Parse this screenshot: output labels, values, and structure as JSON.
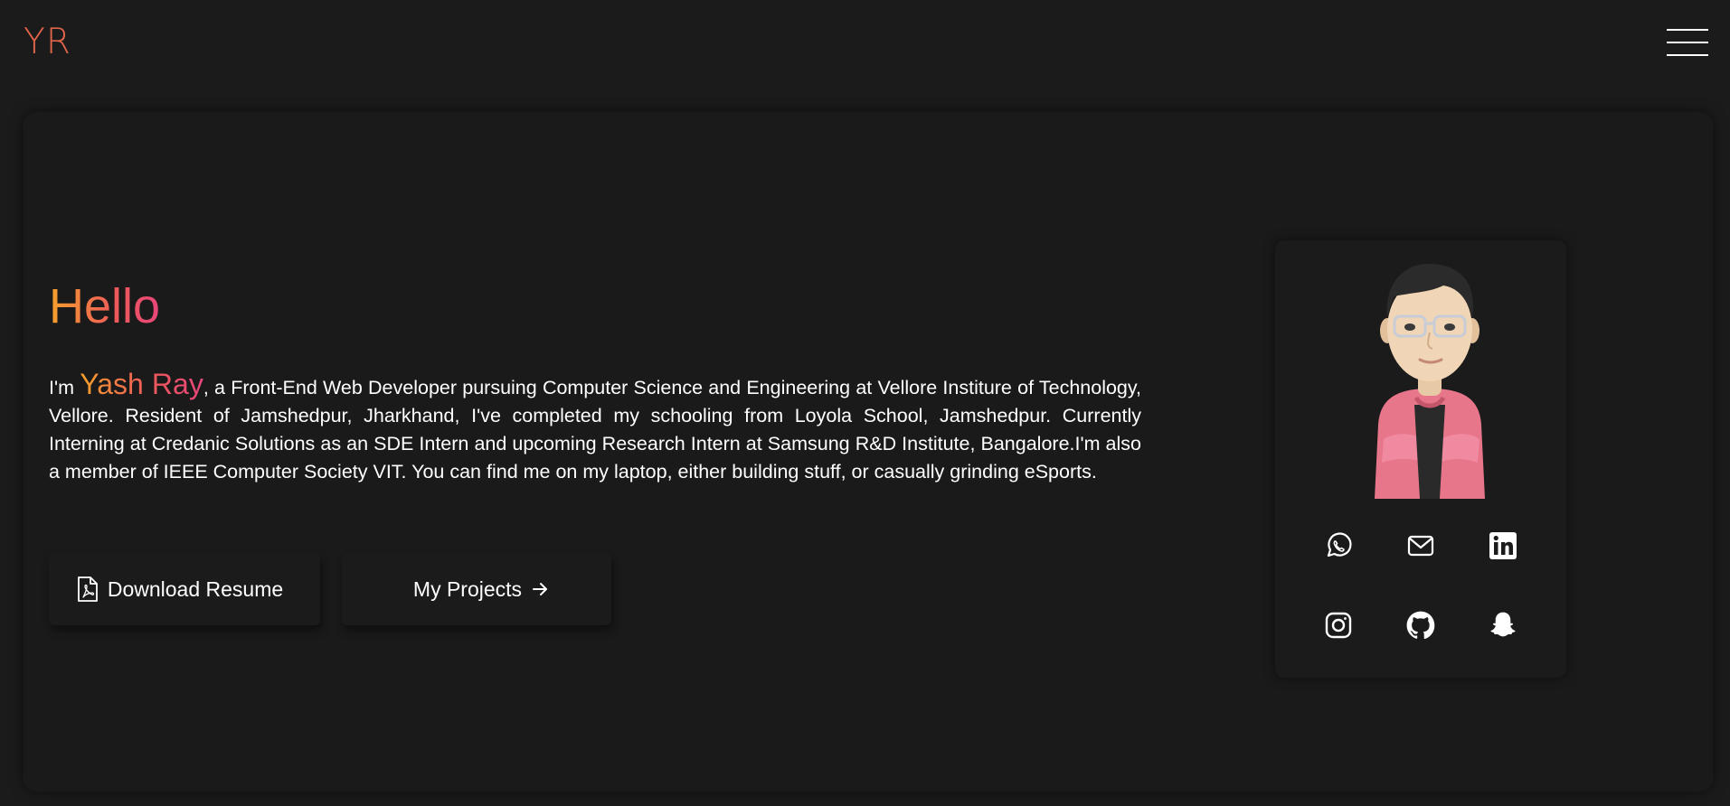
{
  "header": {
    "logo": "YR",
    "menu_icon": "hamburger-menu-icon"
  },
  "hero": {
    "greeting": "Hello",
    "bio_prefix": "I'm ",
    "name": "Yash Ray",
    "bio_rest": ", a Front-End Web Developer pursuing Computer Science and Engineering at Vellore Institure of Technology, Vellore. Resident of Jamshedpur, Jharkhand, I've completed my schooling from Loyola School, Jamshedpur. Currently Interning at Credanic Solutions as an SDE Intern and upcoming Research Intern at Samsung R&D Institute, Bangalore.I'm also a member of IEEE Computer Society VIT. You can find me on my laptop, either building stuff, or casually grinding eSports."
  },
  "buttons": {
    "resume_label": "Download Resume",
    "resume_icon": "pdf-file-icon",
    "projects_label": "My Projects",
    "projects_icon": "arrow-right-icon"
  },
  "profile": {
    "avatar": "memoji-avatar",
    "socials": [
      {
        "icon": "whatsapp-icon"
      },
      {
        "icon": "mail-icon"
      },
      {
        "icon": "linkedin-icon"
      },
      {
        "icon": "instagram-icon"
      },
      {
        "icon": "github-icon"
      },
      {
        "icon": "snapchat-icon"
      }
    ]
  },
  "colors": {
    "background": "#1b1b1b",
    "logo": "#e0654b",
    "gradient_start": "#f5a12b",
    "gradient_end": "#e8467a",
    "text": "#ffffff"
  }
}
